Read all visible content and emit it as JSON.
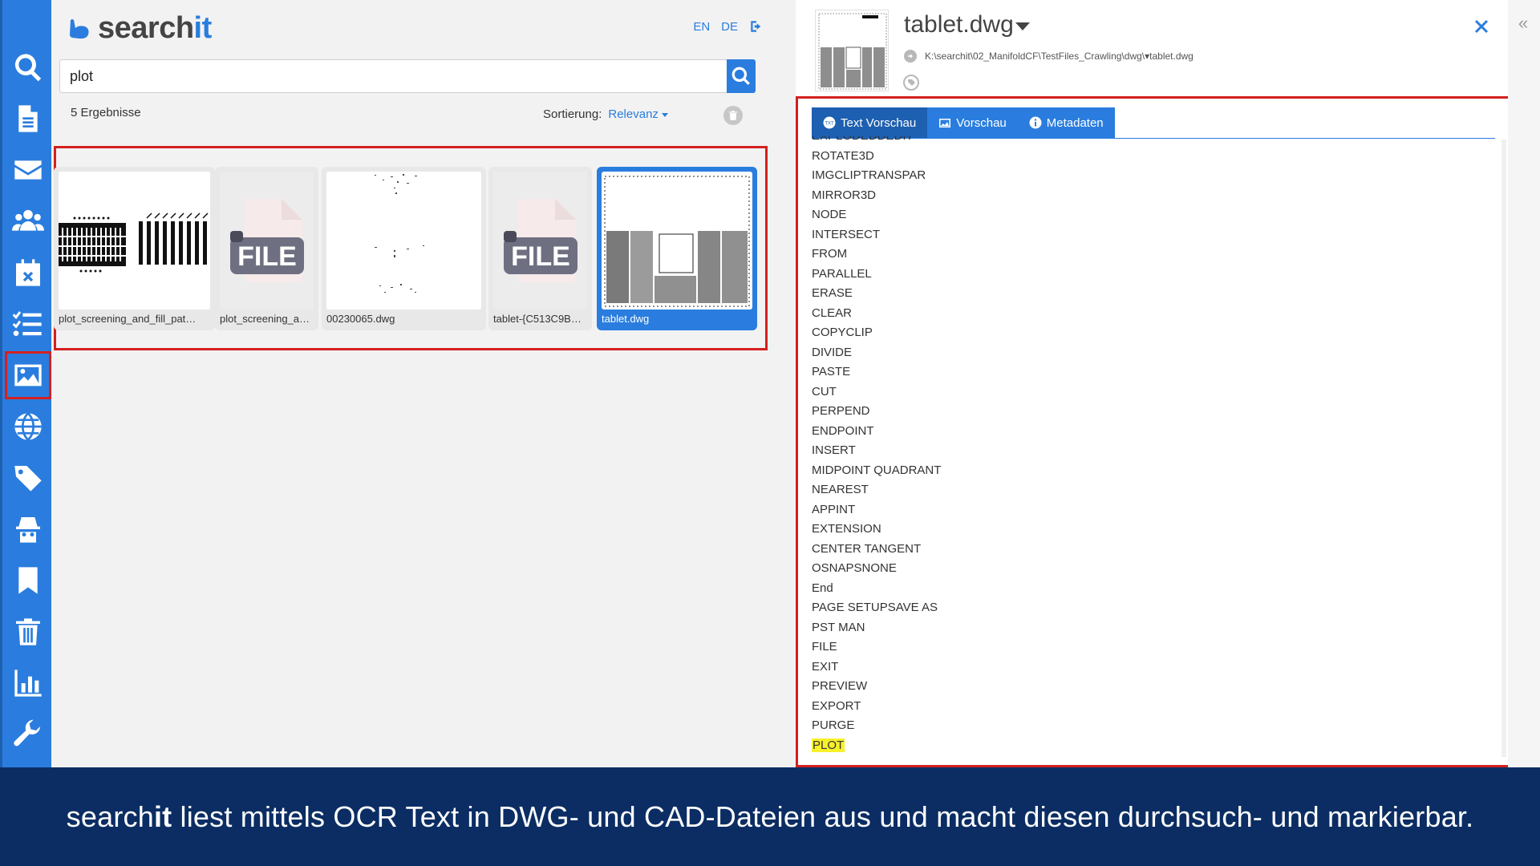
{
  "app": {
    "logo_left": "search",
    "logo_right": "it"
  },
  "header": {
    "lang_en": "EN",
    "lang_de": "DE",
    "logout_icon": "sign-out-icon"
  },
  "sidebar": {
    "items": [
      {
        "name": "search-icon"
      },
      {
        "name": "document-icon"
      },
      {
        "name": "envelope-icon"
      },
      {
        "name": "users-icon"
      },
      {
        "name": "calendar-x-icon"
      },
      {
        "name": "tasklist-icon"
      },
      {
        "name": "image-icon",
        "active": true
      },
      {
        "name": "globe-icon"
      },
      {
        "name": "tags-icon"
      },
      {
        "name": "spy-icon"
      },
      {
        "name": "bookmark-icon"
      },
      {
        "name": "trash-icon"
      },
      {
        "name": "chart-icon"
      },
      {
        "name": "wrench-icon"
      }
    ]
  },
  "search": {
    "query": "plot",
    "result_count": "5 Ergebnisse",
    "sort_label": "Sortierung:",
    "sort_value": "Relevanz"
  },
  "results": [
    {
      "caption": "plot_screening_and_fill_pat…",
      "kind": "barcode"
    },
    {
      "caption": "plot_screening_a…",
      "kind": "file"
    },
    {
      "caption": "00230065.dwg",
      "kind": "sparse"
    },
    {
      "caption": "tablet-{C513C9B…",
      "kind": "file"
    },
    {
      "caption": "tablet.dwg",
      "kind": "drawing",
      "selected": true
    }
  ],
  "file_placeholder": "FILE",
  "detail": {
    "title": "tablet.dwg",
    "path": "K:\\searchit\\02_ManifoldCF\\TestFiles_Crawling\\dwg\\▾tablet.dwg",
    "tabs": [
      {
        "label": "Text Vorschau",
        "icon": "txt-icon",
        "active": true
      },
      {
        "label": "Vorschau",
        "icon": "image-icon"
      },
      {
        "label": "Metadaten",
        "icon": "info-icon"
      }
    ],
    "lines": [
      "EXPLODEDDEDIT",
      "ROTATE3D",
      "IMGCLIPTRANSPAR",
      "MIRROR3D",
      "NODE",
      "INTERSECT",
      "FROM",
      "PARALLEL",
      "ERASE",
      "CLEAR",
      "COPYCLIP",
      "DIVIDE",
      "PASTE",
      "CUT",
      "PERPEND",
      "ENDPOINT",
      "INSERT",
      "MIDPOINT QUADRANT",
      "NEAREST",
      "APPINT",
      "EXTENSION",
      "CENTER TANGENT",
      "OSNAPSNONE",
      "End",
      "PAGE SETUPSAVE AS",
      "PST MAN",
      "FILE",
      "EXIT",
      "PREVIEW",
      "EXPORT",
      "PURGE",
      "PLOT"
    ],
    "highlight_line": "PLOT"
  },
  "caption": {
    "part1": "search",
    "part2": "it",
    "part3": " liest mittels OCR Text in DWG- und CAD-Dateien aus und macht diesen durchsuch- und markierbar."
  },
  "colors": {
    "brand": "#2a7dde",
    "brand_dark": "#1d5fb0",
    "highlight": "#f8f02a",
    "frame": "#d42020",
    "caption_bg": "#0b2d63"
  }
}
